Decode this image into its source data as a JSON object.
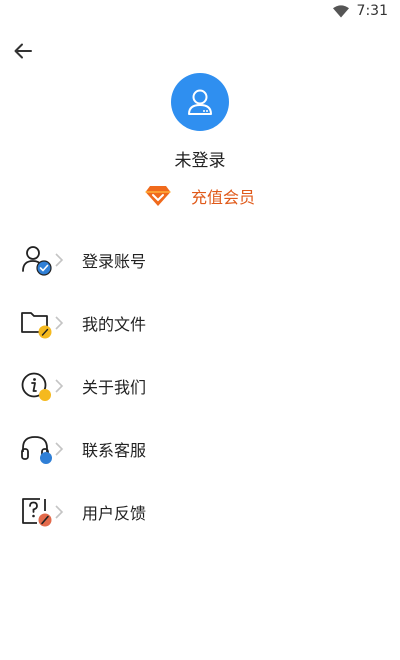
{
  "status_bar": {
    "time": "7:31",
    "icons": [
      "wifi-icon",
      "battery-icon"
    ]
  },
  "header": {
    "back_icon": "arrow-left-icon"
  },
  "profile": {
    "username": "未登录",
    "avatar_icon": "user-icon",
    "avatar_color": "#2f8ff0",
    "vip_label": "充值会员",
    "vip_icon": "diamond-icon",
    "vip_color": "#e05a1a"
  },
  "menu": {
    "items": [
      {
        "label": "登录账号",
        "icon": "user-login-icon",
        "badge_color": "#2f7fd6"
      },
      {
        "label": "我的文件",
        "icon": "folder-icon",
        "badge_color": "#f5b91e"
      },
      {
        "label": "关于我们",
        "icon": "info-icon",
        "badge_color": "#f5b91e"
      },
      {
        "label": "联系客服",
        "icon": "headset-icon",
        "badge_color": "#2f7fd6"
      },
      {
        "label": "用户反馈",
        "icon": "feedback-icon",
        "badge_color": "#e36a4b"
      }
    ]
  }
}
